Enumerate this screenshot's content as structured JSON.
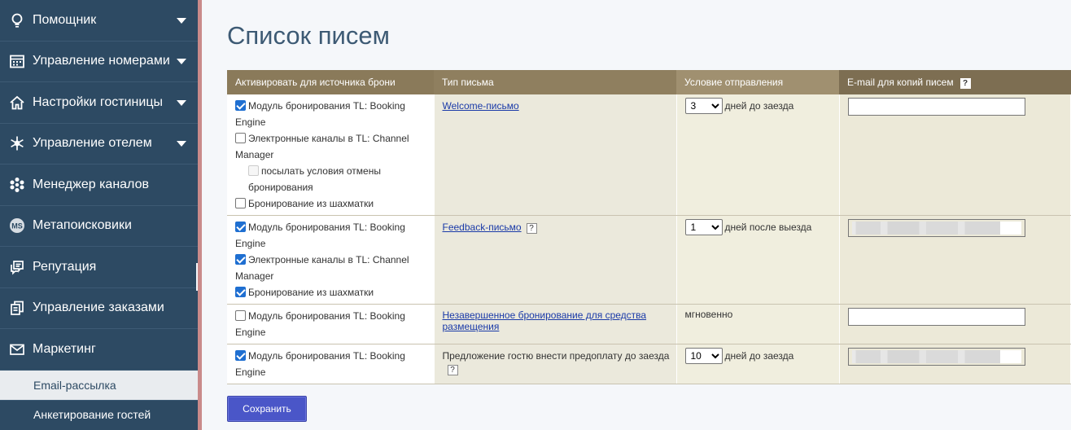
{
  "sidebar": {
    "items": [
      {
        "label": "Помощник",
        "icon": "lightbulb-icon",
        "has_caret": true
      },
      {
        "label": "Управление номерами",
        "icon": "calendar-icon",
        "has_caret": true
      },
      {
        "label": "Настройки гостиницы",
        "icon": "home-icon",
        "has_caret": true
      },
      {
        "label": "Управление отелем",
        "icon": "snowflake-icon",
        "has_caret": true
      },
      {
        "label": "Менеджер каналов",
        "icon": "network-icon",
        "has_caret": false
      },
      {
        "label": "Метапоисковики",
        "icon": "ms-badge-icon",
        "icon_text": "MS",
        "has_caret": false
      },
      {
        "label": "Репутация",
        "icon": "chat-bubbles-icon",
        "has_caret": false
      },
      {
        "label": "Управление заказами",
        "icon": "orders-icon",
        "has_caret": false
      },
      {
        "label": "Маркетинг",
        "icon": "envelope-icon",
        "has_caret": false
      }
    ],
    "subitems": [
      {
        "label": "Email-рассылка",
        "active": false
      },
      {
        "label": "Анкетирование гостей",
        "active": true
      }
    ]
  },
  "main": {
    "title": "Список писем",
    "table": {
      "headers": {
        "source": "Активировать для источника брони",
        "type": "Тип письма",
        "condition": "Условие отправления",
        "email": "E-mail для копий писем",
        "email_help": "?"
      },
      "rows": [
        {
          "sources": [
            {
              "label": "Модуль бронирования TL: Booking Engine",
              "checked": true
            },
            {
              "label": "Электронные каналы в TL: Channel Manager",
              "checked": false
            },
            {
              "label": "посылать условия отмены бронирования",
              "checked": false,
              "disabled": true
            },
            {
              "label": "Бронирование из шахматки",
              "checked": false
            }
          ],
          "type_label": "Welcome-письмо",
          "days": "3",
          "condition_text": "дней  до заезда",
          "email_value": ""
        },
        {
          "sources": [
            {
              "label": "Модуль бронирования TL: Booking Engine",
              "checked": true
            },
            {
              "label": "Электронные каналы в TL: Channel Manager",
              "checked": true
            },
            {
              "label": "Бронирование из шахматки",
              "checked": true
            }
          ],
          "type_label": "Feedback-письмо",
          "type_help": "?",
          "days": "1",
          "condition_text": "дней после выезда",
          "email_value": "blurred"
        },
        {
          "sources": [
            {
              "label": "Модуль бронирования TL: Booking Engine",
              "checked": false
            }
          ],
          "type_label": "Незавершенное бронирование для средства размещения",
          "condition_text": "мгновенно",
          "email_value": ""
        },
        {
          "sources": [
            {
              "label": "Модуль бронирования TL: Booking Engine",
              "checked": true
            }
          ],
          "type_label": "Предложение гостю внести предоплату до заезда",
          "type_help": "?",
          "days": "10",
          "condition_text": "дней  до заезда",
          "email_value": "blurred"
        }
      ]
    },
    "save_label": "Сохранить"
  },
  "colors": {
    "sidebar_bg": "#2d4a63",
    "title": "#3d5a74",
    "header_brown": "#8a7a5a",
    "save_button": "#4a56c8",
    "link": "#1a3aa8"
  }
}
